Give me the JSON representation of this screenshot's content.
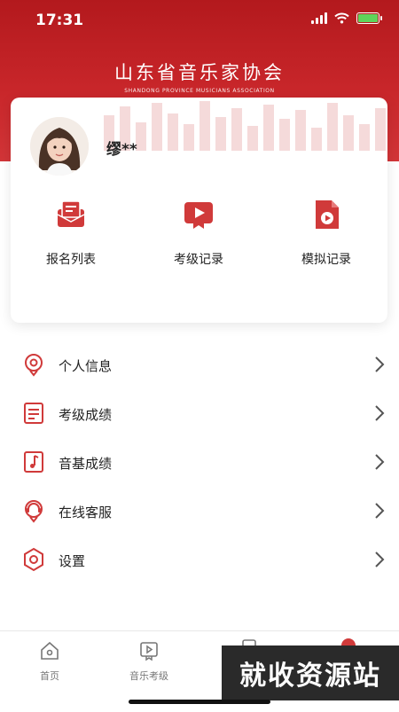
{
  "status_bar": {
    "time": "17:31"
  },
  "brand": {
    "name": "山东省音乐家协会",
    "subtitle": "SHANDONG PROVINCE MUSICIANS ASSOCIATION"
  },
  "profile": {
    "name": "缪**"
  },
  "quick_actions": [
    {
      "label": "报名列表",
      "icon": "registration-icon"
    },
    {
      "label": "考级记录",
      "icon": "video-record-icon"
    },
    {
      "label": "模拟记录",
      "icon": "document-play-icon"
    }
  ],
  "menu": [
    {
      "label": "个人信息",
      "icon": "person-info-icon"
    },
    {
      "label": "考级成绩",
      "icon": "score-sheet-icon"
    },
    {
      "label": "音基成绩",
      "icon": "music-note-icon"
    },
    {
      "label": "在线客服",
      "icon": "customer-service-icon"
    },
    {
      "label": "设置",
      "icon": "settings-icon"
    }
  ],
  "tabbar": [
    {
      "label": "首页",
      "icon": "home-icon"
    },
    {
      "label": "音乐考级",
      "icon": "exam-play-icon"
    }
  ],
  "watermark": "就收资源站",
  "colors": {
    "brand_red": "#c8262a",
    "icon_red": "#d03a3a"
  }
}
